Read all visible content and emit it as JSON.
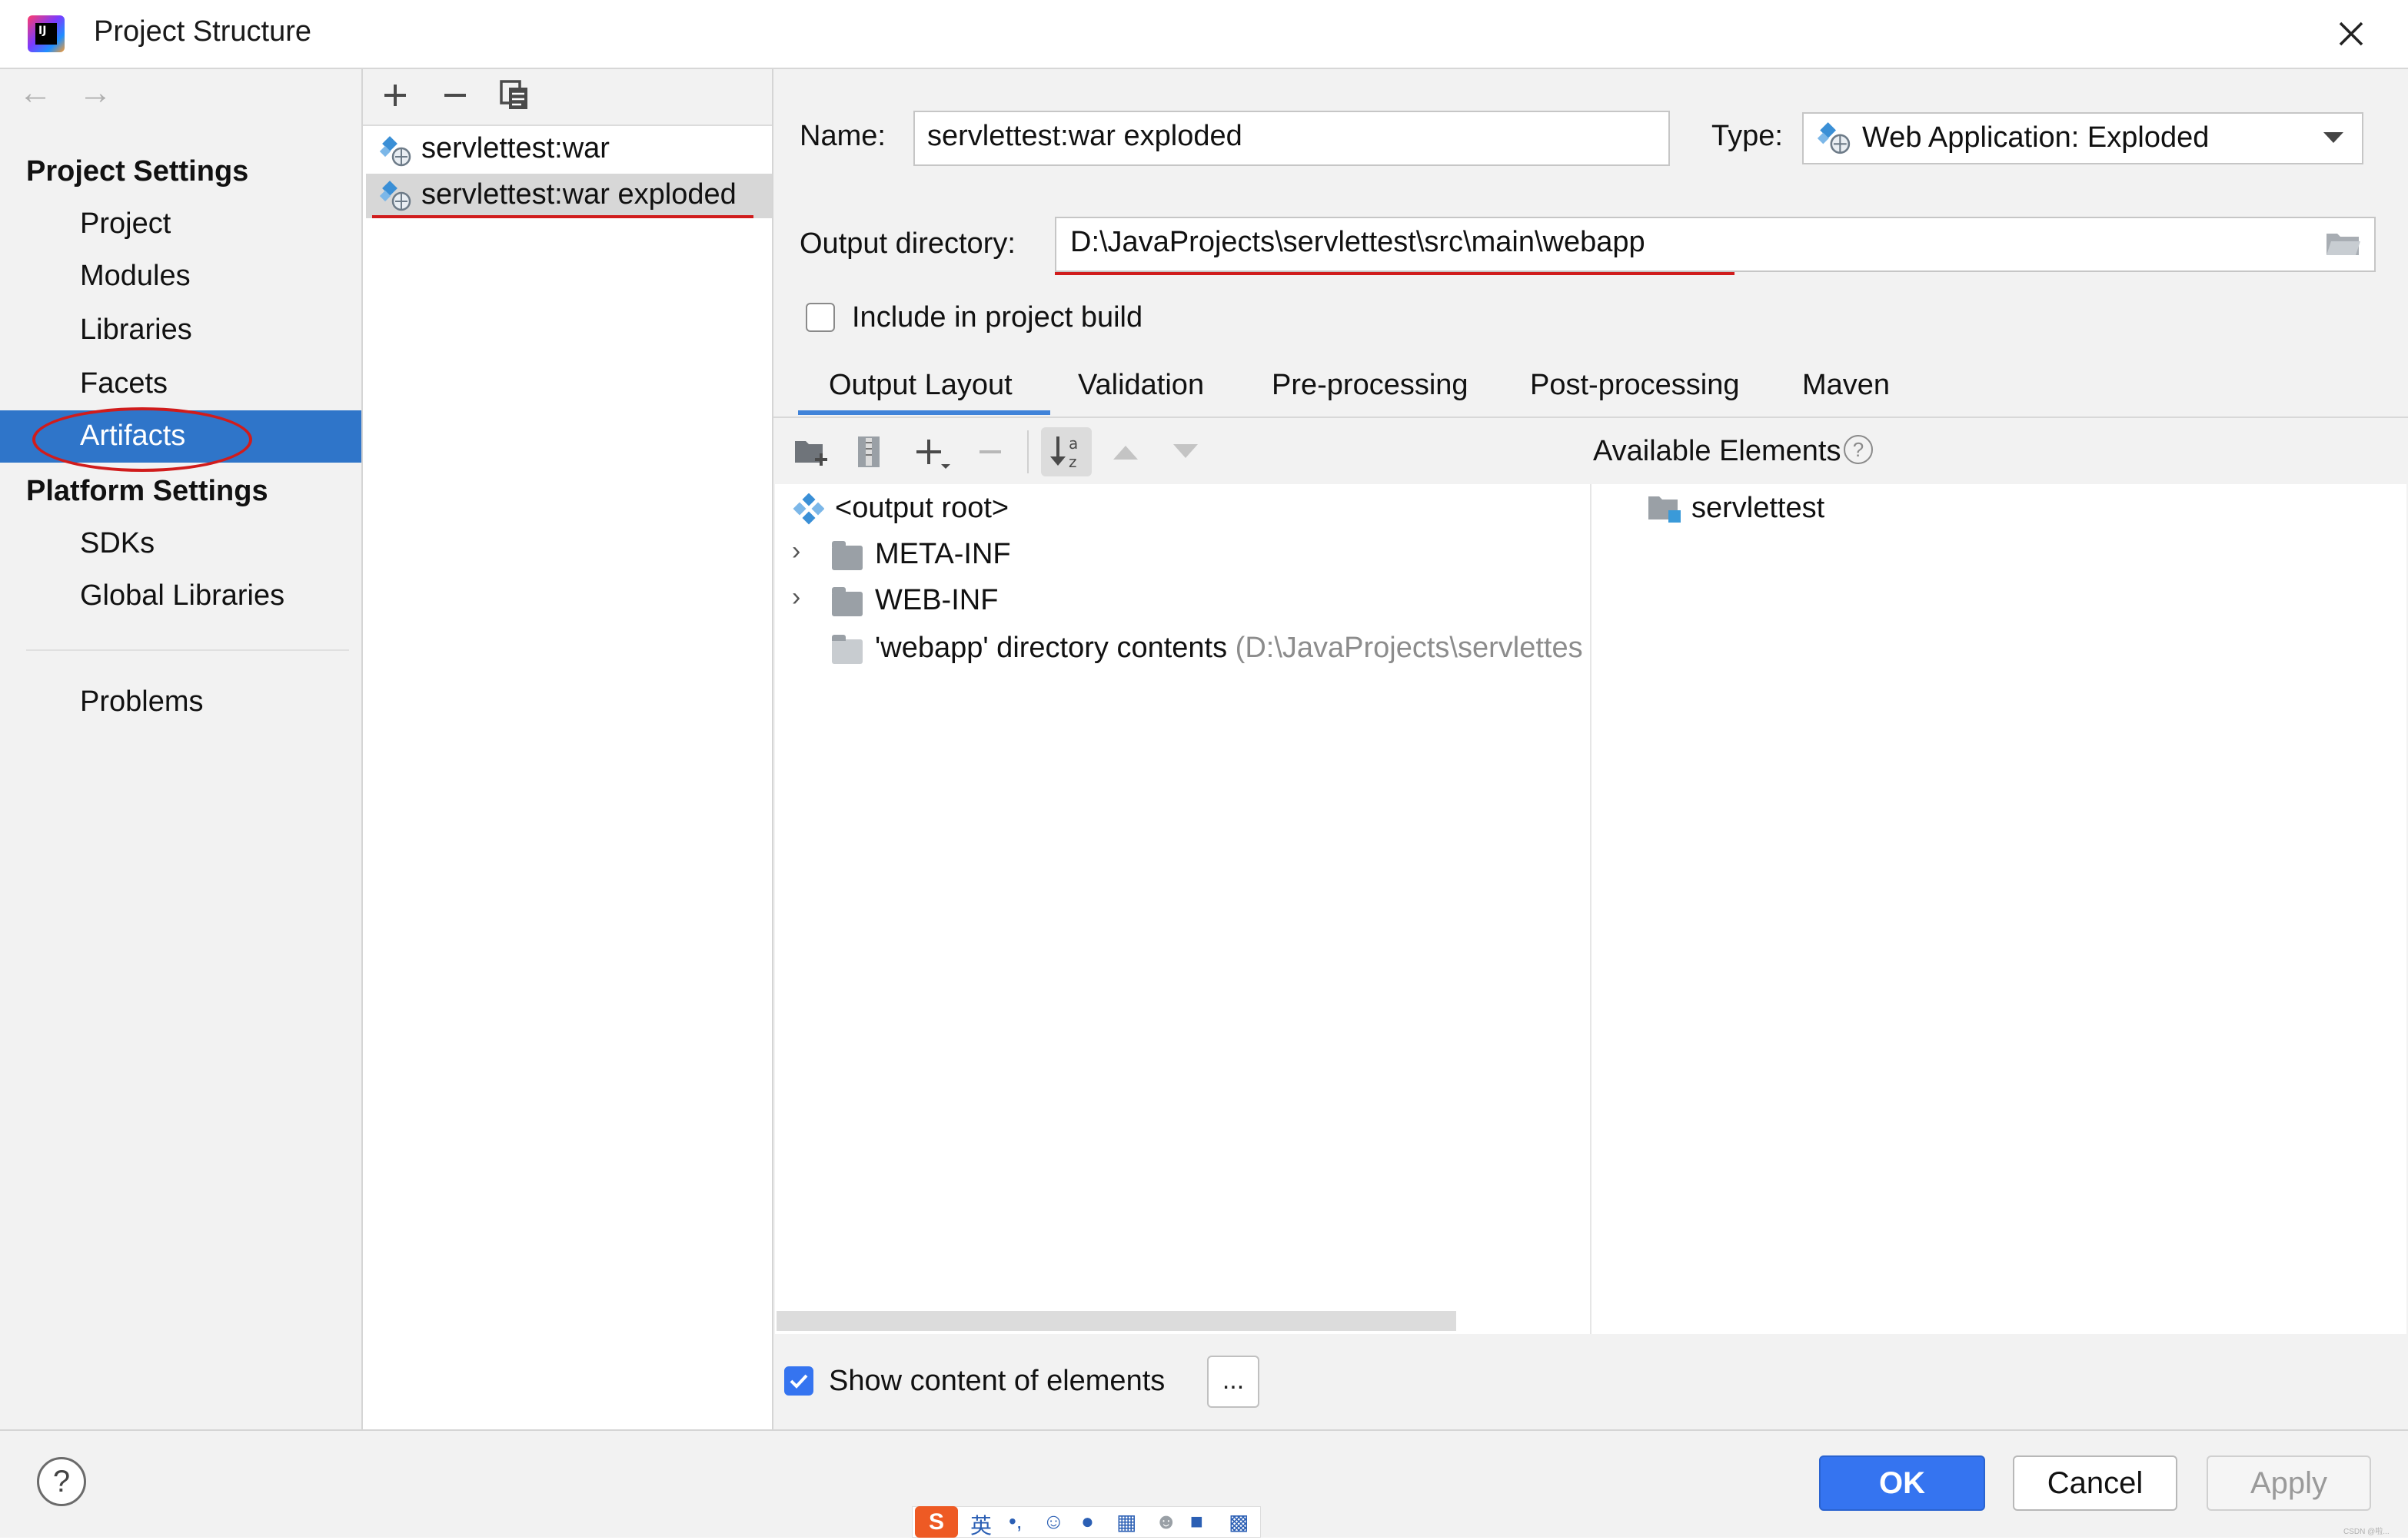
{
  "window": {
    "title": "Project Structure"
  },
  "sidebar": {
    "project_settings_heading": "Project Settings",
    "project_items": [
      "Project",
      "Modules",
      "Libraries",
      "Facets",
      "Artifacts"
    ],
    "platform_settings_heading": "Platform Settings",
    "platform_items": [
      "SDKs",
      "Global Libraries"
    ],
    "problems": "Problems",
    "selected": "Artifacts"
  },
  "artifact_list": {
    "items": [
      "servlettest:war",
      "servlettest:war exploded"
    ],
    "selected_index": 1
  },
  "form": {
    "name_label": "Name:",
    "name_value": "servlettest:war exploded",
    "type_label": "Type:",
    "type_value": "Web Application: Exploded",
    "output_dir_label": "Output directory:",
    "output_dir_value": "D:\\JavaProjects\\servlettest\\src\\main\\webapp",
    "include_build_label": "Include in project build",
    "include_build_checked": false
  },
  "tabs": {
    "items": [
      "Output Layout",
      "Validation",
      "Pre-processing",
      "Post-processing",
      "Maven"
    ],
    "active": "Output Layout"
  },
  "layout_tree": {
    "root": "<output root>",
    "nodes": [
      "META-INF",
      "WEB-INF"
    ],
    "webapp_label": "'webapp' directory contents",
    "webapp_path": "(D:\\JavaProjects\\servlettes"
  },
  "available": {
    "header": "Available Elements",
    "help_glyph": "?",
    "items": [
      "servlettest"
    ]
  },
  "footer": {
    "show_content_label": "Show content of elements",
    "show_content_checked": true,
    "ellipsis": "...",
    "help": "?",
    "ok": "OK",
    "cancel": "Cancel",
    "apply": "Apply"
  },
  "ime": {
    "logo": "S",
    "lang": "英"
  },
  "watermark": "CSDN @啦..."
}
